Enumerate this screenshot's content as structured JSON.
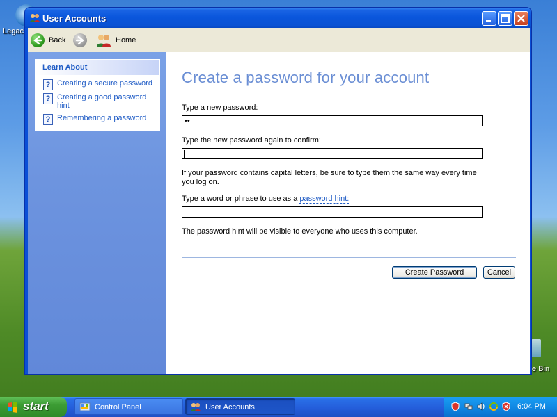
{
  "desktop": {
    "left_icon_label": "Legacy",
    "right_icon_label": "e Bin"
  },
  "window": {
    "title": "User Accounts",
    "toolbar": {
      "back_label": "Back",
      "home_label": "Home"
    }
  },
  "sidebar": {
    "heading": "Learn About",
    "items": [
      {
        "label": "Creating a secure password"
      },
      {
        "label": "Creating a good password hint"
      },
      {
        "label": "Remembering a password"
      }
    ]
  },
  "form": {
    "heading": "Create a password for your account",
    "new_password_label": "Type a new password:",
    "new_password_value": "••",
    "confirm_label": "Type the new password again to confirm:",
    "confirm_value": "",
    "caps_note": "If your password contains capital letters, be sure to type them the same way every time you log on.",
    "hint_label_prefix": "Type a word or phrase to use as a ",
    "hint_label_link": "password hint:",
    "hint_value": "",
    "visibility_note": "The password hint will be visible to everyone who uses this computer.",
    "create_button": "Create Password",
    "cancel_button": "Cancel"
  },
  "taskbar": {
    "start_label": "start",
    "tasks": [
      {
        "label": "Control Panel"
      },
      {
        "label": "User Accounts",
        "active": true
      }
    ],
    "clock": "6:04 PM"
  },
  "colors": {
    "title_blue": "#0a56dc",
    "side_pane": "#6d94df",
    "link_blue": "#215dc6",
    "heading_blue": "#6a8ed4",
    "start_green": "#3c9c34"
  }
}
